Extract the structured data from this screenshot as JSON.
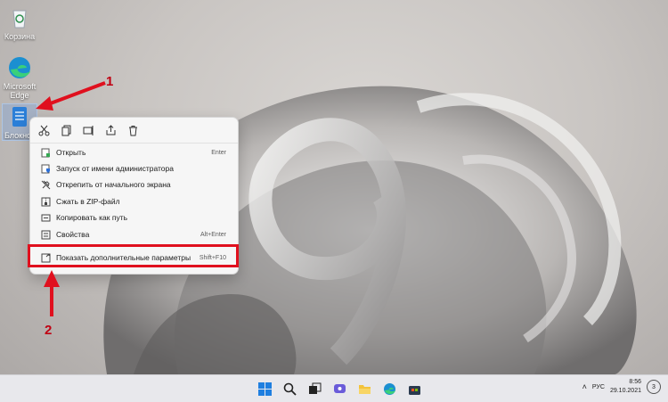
{
  "desktop": {
    "icons": [
      {
        "label": "Корзина",
        "icon": "recycle-bin-icon"
      },
      {
        "label": "Microsoft Edge",
        "icon": "edge-icon"
      },
      {
        "label": "Блокнот",
        "icon": "notepad-icon"
      }
    ]
  },
  "context_menu": {
    "toolbar": [
      "cut-icon",
      "copy-icon",
      "rename-icon",
      "share-icon",
      "delete-icon"
    ],
    "items": [
      {
        "label": "Открыть",
        "shortcut": "Enter",
        "icon": "open-icon"
      },
      {
        "label": "Запуск от имени администратора",
        "shortcut": "",
        "icon": "admin-shield-icon"
      },
      {
        "label": "Открепить от начального экрана",
        "shortcut": "",
        "icon": "unpin-icon"
      },
      {
        "label": "Сжать в ZIP-файл",
        "shortcut": "",
        "icon": "zip-icon"
      },
      {
        "label": "Копировать как путь",
        "shortcut": "",
        "icon": "copy-path-icon"
      },
      {
        "label": "Свойства",
        "shortcut": "Alt+Enter",
        "icon": "properties-icon"
      },
      {
        "label": "Показать дополнительные параметры",
        "shortcut": "Shift+F10",
        "icon": "more-options-icon"
      }
    ]
  },
  "annotations": {
    "marker1": "1",
    "marker2": "2",
    "color": "#e0101e"
  },
  "taskbar": {
    "apps": [
      "start-icon",
      "search-icon",
      "task-view-icon",
      "chat-icon",
      "file-explorer-icon",
      "edge-icon",
      "store-icon"
    ],
    "tray": {
      "language": "РУС",
      "time": "8:56",
      "date": "29.10.2021",
      "notifications": "3"
    }
  }
}
